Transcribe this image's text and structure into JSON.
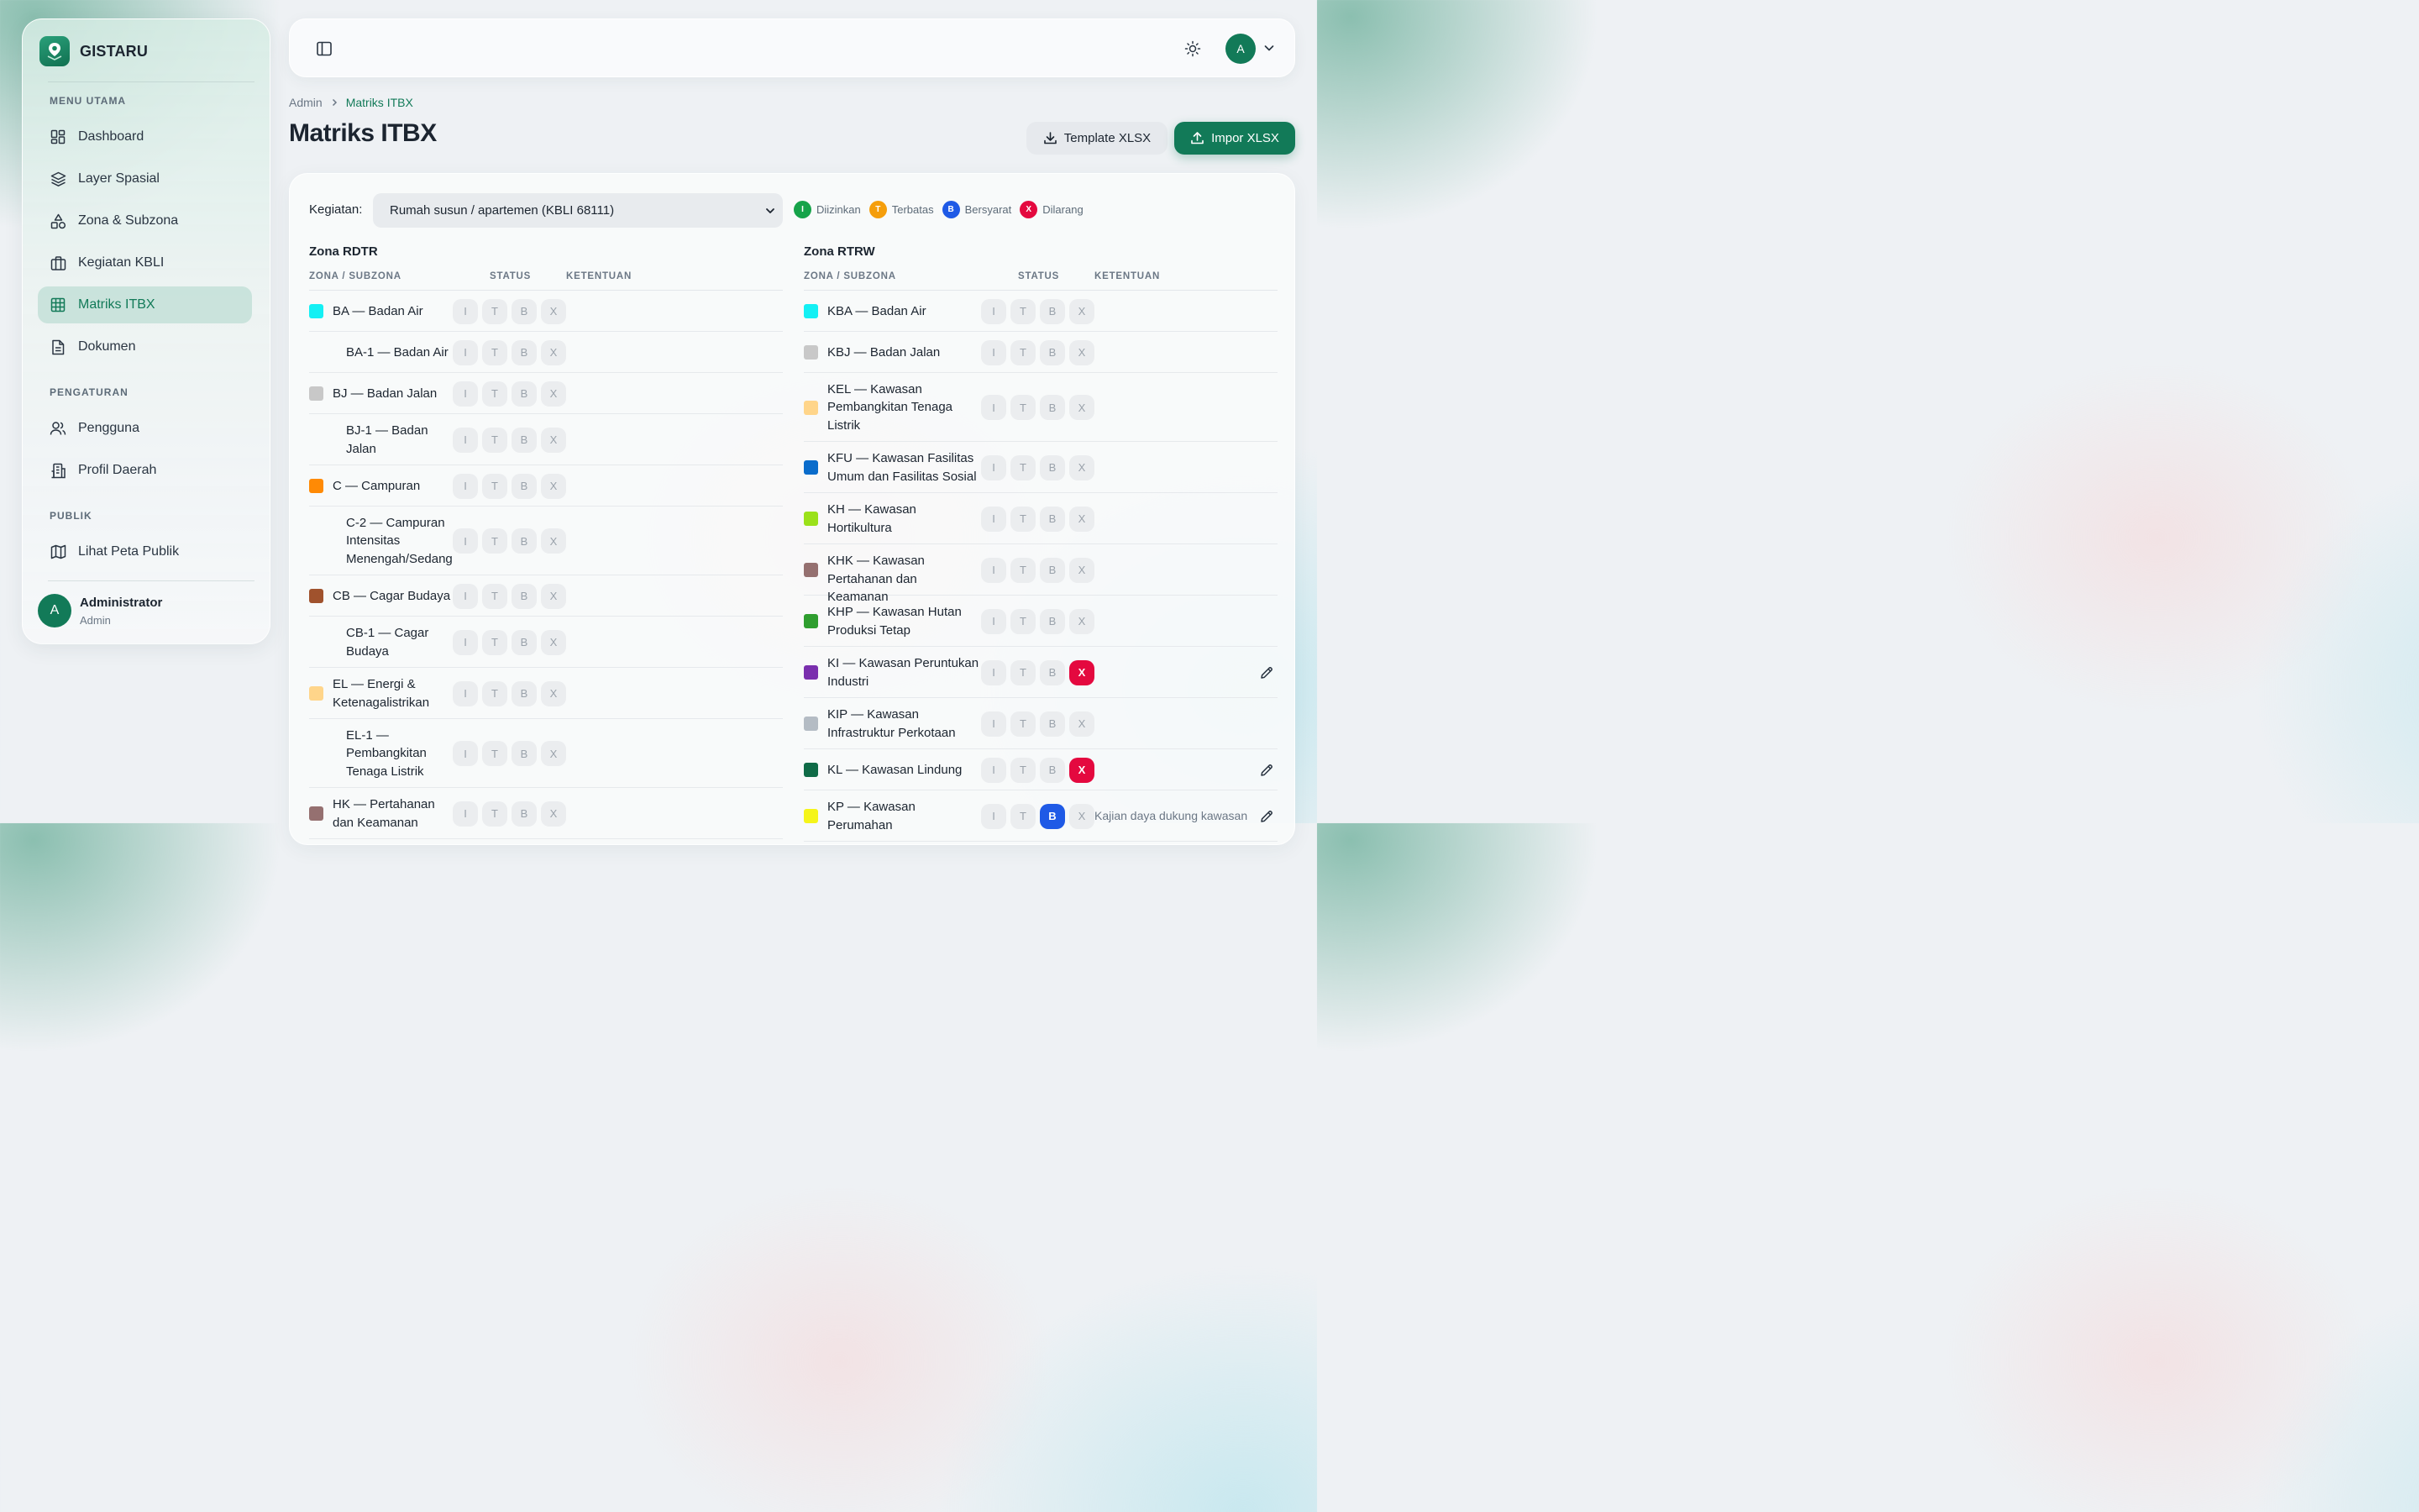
{
  "brand": {
    "name": "GISTARU"
  },
  "sidebar": {
    "sections": [
      "MENU UTAMA",
      "PENGATURAN",
      "PUBLIK"
    ],
    "items": [
      {
        "label": "Dashboard",
        "icon": "dashboard-icon"
      },
      {
        "label": "Layer Spasial",
        "icon": "layers-icon"
      },
      {
        "label": "Zona & Subzona",
        "icon": "shapes-icon"
      },
      {
        "label": "Kegiatan KBLI",
        "icon": "briefcase-icon"
      },
      {
        "label": "Matriks ITBX",
        "icon": "table-icon",
        "active": true
      },
      {
        "label": "Dokumen",
        "icon": "document-icon"
      },
      {
        "label": "Pengguna",
        "icon": "users-icon"
      },
      {
        "label": "Profil Daerah",
        "icon": "building-icon"
      },
      {
        "label": "Lihat Peta Publik",
        "icon": "map-icon"
      }
    ],
    "user": {
      "initial": "A",
      "name": "Administrator",
      "role": "Admin"
    }
  },
  "topbar": {
    "avatar_initial": "A"
  },
  "breadcrumb": {
    "root": "Admin",
    "current": "Matriks ITBX"
  },
  "page": {
    "title": "Matriks ITBX",
    "template_label": "Template XLSX",
    "import_label": "Impor XLSX"
  },
  "filter": {
    "label": "Kegiatan:",
    "selected": "Rumah susun / apartemen (KBLI 68111)"
  },
  "legend": [
    {
      "code": "I",
      "label": "Diizinkan",
      "color": "#16a34a"
    },
    {
      "code": "T",
      "label": "Terbatas",
      "color": "#f59e0b"
    },
    {
      "code": "B",
      "label": "Bersyarat",
      "color": "#1f5ae6"
    },
    {
      "code": "X",
      "label": "Dilarang",
      "color": "#e4093f"
    }
  ],
  "status_codes": [
    "I",
    "T",
    "B",
    "X"
  ],
  "columns": {
    "zona": "ZONA / SUBZONA",
    "status": "STATUS",
    "ketentuan": "KETENTUAN"
  },
  "rdtr": {
    "title": "Zona RDTR",
    "rows": [
      {
        "label": "BA — Badan Air",
        "color": "#14f0f4",
        "sub": false,
        "lines": 1,
        "selected": null
      },
      {
        "label": "BA-1 — Badan Air",
        "color": null,
        "sub": true,
        "lines": 1,
        "selected": null
      },
      {
        "label": "BJ — Badan Jalan",
        "color": "#c8c8c8",
        "sub": false,
        "lines": 1,
        "selected": null
      },
      {
        "label": "BJ-1 — Badan Jalan",
        "color": null,
        "sub": true,
        "lines": 2,
        "selected": null
      },
      {
        "label": "C — Campuran",
        "color": "#ff8a05",
        "sub": false,
        "lines": 1,
        "selected": null
      },
      {
        "label": "C-2 — Campuran Intensitas Menengah/Sedang",
        "color": null,
        "sub": true,
        "lines": 3,
        "selected": null
      },
      {
        "label": "CB — Cagar Budaya",
        "color": "#a0522d",
        "sub": false,
        "lines": 1,
        "selected": null
      },
      {
        "label": "CB-1 — Cagar Budaya",
        "color": null,
        "sub": true,
        "lines": 2,
        "selected": null
      },
      {
        "label": "EL — Energi & Ketenagalistrikan",
        "color": "#ffd58a",
        "sub": false,
        "lines": 2,
        "selected": null
      },
      {
        "label": "EL-1 — Pembangkitan Tenaga Listrik",
        "color": null,
        "sub": true,
        "lines": 3,
        "selected": null
      },
      {
        "label": "HK — Pertahanan dan Keamanan",
        "color": "#957070",
        "sub": false,
        "lines": 2,
        "selected": null
      }
    ]
  },
  "rtrw": {
    "title": "Zona RTRW",
    "rows": [
      {
        "label": "KBA — Badan Air",
        "color": "#14f0f4",
        "lines": 1,
        "selected": null,
        "note": ""
      },
      {
        "label": "KBJ — Badan Jalan",
        "color": "#c8c8c8",
        "lines": 1,
        "selected": null,
        "note": ""
      },
      {
        "label": "KEL — Kawasan Pembangkitan Tenaga Listrik",
        "color": "#ffd58a",
        "lines": 3,
        "selected": null,
        "note": ""
      },
      {
        "label": "KFU — Kawasan Fasilitas Umum dan Fasilitas Sosial",
        "color": "#0a6ccb",
        "lines": 2,
        "selected": null,
        "note": ""
      },
      {
        "label": "KH — Kawasan Hortikultura",
        "color": "#9be11a",
        "lines": 2,
        "selected": null,
        "note": ""
      },
      {
        "label": "KHK — Kawasan Pertahanan dan Keamanan",
        "color": "#957070",
        "lines": 2,
        "selected": null,
        "note": ""
      },
      {
        "label": "KHP — Kawasan Hutan Produksi Tetap",
        "color": "#2f9e2f",
        "lines": 2,
        "selected": null,
        "note": ""
      },
      {
        "label": "KI — Kawasan Peruntukan Industri",
        "color": "#7a2fae",
        "lines": 2,
        "selected": "X",
        "note": ""
      },
      {
        "label": "KIP — Kawasan Infrastruktur Perkotaan",
        "color": "#b4bcc4",
        "lines": 2,
        "selected": null,
        "note": ""
      },
      {
        "label": "KL — Kawasan Lindung",
        "color": "#0f6b47",
        "lines": 1,
        "selected": "X",
        "note": ""
      },
      {
        "label": "KP — Kawasan Perumahan",
        "color": "#f5f51a",
        "lines": 2,
        "selected": "B",
        "note": "Kajian daya dukung kawasan"
      }
    ]
  }
}
